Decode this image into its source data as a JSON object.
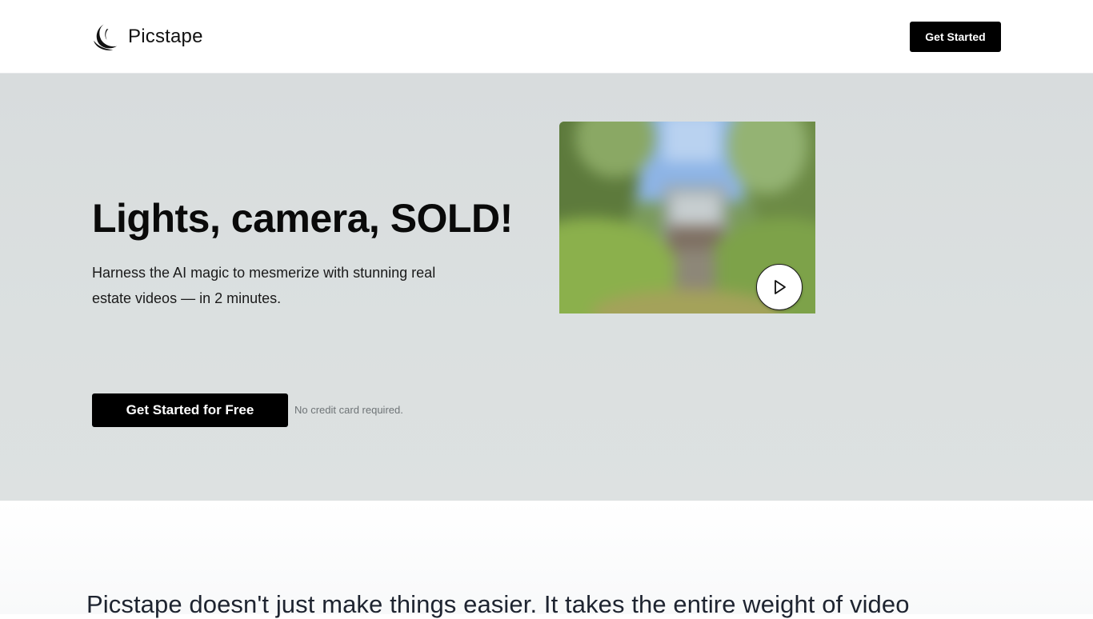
{
  "header": {
    "brand_name": "Picstape",
    "logo_icon": "crescent-moon-logo-icon",
    "cta_label": "Get Started"
  },
  "hero": {
    "title": "Lights, camera, SOLD!",
    "subtitle": "Harness the AI magic to mesmerize with stunning real estate videos — in 2 minutes.",
    "primary_cta_label": "Get Started for Free",
    "cta_note": "No credit card required.",
    "video": {
      "thumbnail_description": "blurred house-with-trees-thumbnail",
      "play_icon": "play-icon"
    }
  },
  "intro": {
    "text": "Picstape doesn't just make things easier. It takes the entire weight of video"
  },
  "colors": {
    "primary": "#000000",
    "hero_background": "#d9dddd",
    "text_dark": "#0a0a0a",
    "text_muted": "#6e7376"
  }
}
